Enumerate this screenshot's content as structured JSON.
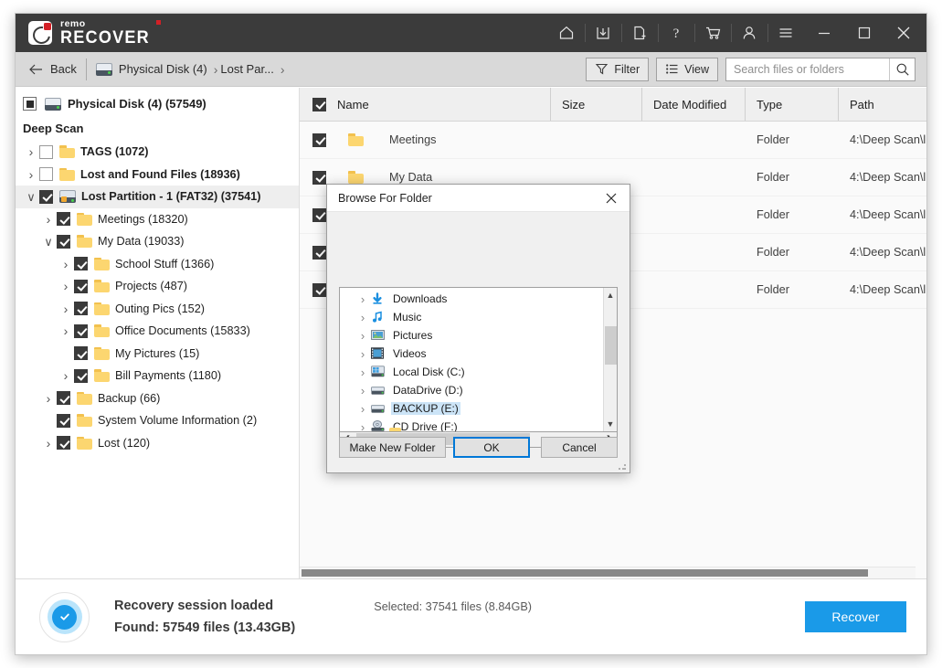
{
  "app": {
    "brand_top": "remo",
    "brand_main": "RECOVER"
  },
  "titlebar": {
    "icons": [
      {
        "name": "home-icon",
        "label": "Home"
      },
      {
        "name": "save-download-icon",
        "label": "Save Session"
      },
      {
        "name": "new-document-icon",
        "label": "New Scan"
      },
      {
        "name": "help-icon",
        "label": "Help"
      },
      {
        "name": "cart-icon",
        "label": "Buy"
      },
      {
        "name": "user-icon",
        "label": "Account"
      },
      {
        "name": "hamburger-menu-icon",
        "label": "Menu"
      },
      {
        "name": "minimize-icon",
        "label": "Minimize"
      },
      {
        "name": "maximize-icon",
        "label": "Maximize"
      },
      {
        "name": "close-icon",
        "label": "Close"
      }
    ]
  },
  "toolbar": {
    "back_label": "Back",
    "breadcrumbs": [
      {
        "label": "Physical Disk (4)",
        "icon": "disk-icon"
      },
      {
        "label": "Lost Par...",
        "icon": null
      }
    ],
    "filter_label": "Filter",
    "view_label": "View",
    "search_placeholder": "Search files or folders",
    "search_value": ""
  },
  "tree": {
    "root": {
      "label": "Physical Disk (4) (57549)",
      "checkbox": "partial"
    },
    "section_label": "Deep Scan",
    "items": [
      {
        "label": "TAGS (1072)",
        "indent": 0,
        "chevron": ">",
        "checkbox": "unchecked",
        "icon": "folder",
        "bold": false,
        "selected": false
      },
      {
        "label": "Lost and Found Files (18936)",
        "indent": 0,
        "chevron": ">",
        "checkbox": "unchecked",
        "icon": "folder",
        "bold": true,
        "selected": false
      },
      {
        "label": "Lost Partition - 1 (FAT32) (37541)",
        "indent": 0,
        "chevron": "v",
        "checkbox": "checked",
        "icon": "disk-lost",
        "bold": true,
        "selected": true
      },
      {
        "label": "Meetings (18320)",
        "indent": 1,
        "chevron": ">",
        "checkbox": "checked",
        "icon": "folder",
        "bold": false,
        "selected": false
      },
      {
        "label": "My Data (19033)",
        "indent": 1,
        "chevron": "v",
        "checkbox": "checked",
        "icon": "folder",
        "bold": false,
        "selected": false
      },
      {
        "label": "School Stuff (1366)",
        "indent": 2,
        "chevron": ">",
        "checkbox": "checked",
        "icon": "folder",
        "bold": false,
        "selected": false
      },
      {
        "label": "Projects (487)",
        "indent": 2,
        "chevron": ">",
        "checkbox": "checked",
        "icon": "folder",
        "bold": false,
        "selected": false
      },
      {
        "label": "Outing Pics (152)",
        "indent": 2,
        "chevron": ">",
        "checkbox": "checked",
        "icon": "folder",
        "bold": false,
        "selected": false
      },
      {
        "label": "Office Documents (15833)",
        "indent": 2,
        "chevron": ">",
        "checkbox": "checked",
        "icon": "folder",
        "bold": false,
        "selected": false
      },
      {
        "label": "My Pictures (15)",
        "indent": 2,
        "chevron": "",
        "checkbox": "checked",
        "icon": "folder",
        "bold": false,
        "selected": false
      },
      {
        "label": "Bill Payments (1180)",
        "indent": 2,
        "chevron": ">",
        "checkbox": "checked",
        "icon": "folder",
        "bold": false,
        "selected": false
      },
      {
        "label": "Backup (66)",
        "indent": 1,
        "chevron": ">",
        "checkbox": "checked",
        "icon": "folder",
        "bold": false,
        "selected": false
      },
      {
        "label": "System Volume Information (2)",
        "indent": 1,
        "chevron": "",
        "checkbox": "checked",
        "icon": "folder",
        "bold": false,
        "selected": false
      },
      {
        "label": "Lost (120)",
        "indent": 1,
        "chevron": ">",
        "checkbox": "checked",
        "icon": "folder",
        "bold": false,
        "selected": false
      }
    ]
  },
  "filelist": {
    "columns": [
      "Name",
      "Size",
      "Date Modified",
      "Type",
      "Path"
    ],
    "header_checkbox": "checked",
    "rows": [
      {
        "checkbox": "checked",
        "name": "Meetings",
        "size": "",
        "date": "",
        "type": "Folder",
        "path": "4:\\Deep Scan\\l"
      },
      {
        "checkbox": "checked",
        "name": "My Data",
        "size": "",
        "date": "",
        "type": "Folder",
        "path": "4:\\Deep Scan\\l"
      },
      {
        "checkbox": "checked",
        "name": "",
        "size": "",
        "date": "",
        "type": "Folder",
        "path": "4:\\Deep Scan\\l"
      },
      {
        "checkbox": "checked",
        "name": "",
        "size": "",
        "date": "",
        "type": "Folder",
        "path": "4:\\Deep Scan\\l"
      },
      {
        "checkbox": "checked",
        "name": "",
        "size": "",
        "date": "",
        "type": "Folder",
        "path": "4:\\Deep Scan\\l"
      }
    ]
  },
  "dialog": {
    "title": "Browse For Folder",
    "close_label": "✕",
    "tree": [
      {
        "label": "Downloads",
        "icon": "downloads-icon",
        "chevron": ">",
        "selected": false
      },
      {
        "label": "Music",
        "icon": "music-icon",
        "chevron": ">",
        "selected": false
      },
      {
        "label": "Pictures",
        "icon": "pictures-icon",
        "chevron": ">",
        "selected": false
      },
      {
        "label": "Videos",
        "icon": "videos-icon",
        "chevron": ">",
        "selected": false
      },
      {
        "label": "Local Disk (C:)",
        "icon": "windows-drive-icon",
        "chevron": ">",
        "selected": false
      },
      {
        "label": "DataDrive (D:)",
        "icon": "drive-icon",
        "chevron": ">",
        "selected": false
      },
      {
        "label": "BACKUP (E:)",
        "icon": "drive-icon",
        "chevron": ">",
        "selected": true
      },
      {
        "label": "CD Drive (F:)",
        "icon": "cd-drive-icon",
        "chevron": ">",
        "selected": false
      }
    ],
    "buttons": {
      "make_new_folder": "Make New Folder",
      "ok": "OK",
      "cancel": "Cancel"
    }
  },
  "statusbar": {
    "line1": "Recovery session loaded",
    "line2": "Found: 57549 files (13.43GB)",
    "selected": "Selected: 37541 files (8.84GB)",
    "recover_label": "Recover"
  },
  "colors": {
    "titlebar": "#3b3b3b",
    "accent_blue": "#1a9ae8",
    "brand_red": "#d32026",
    "folder_yellow": "#fcd670",
    "selection_blue": "#cce4f7",
    "focus_blue": "#0078d7"
  }
}
